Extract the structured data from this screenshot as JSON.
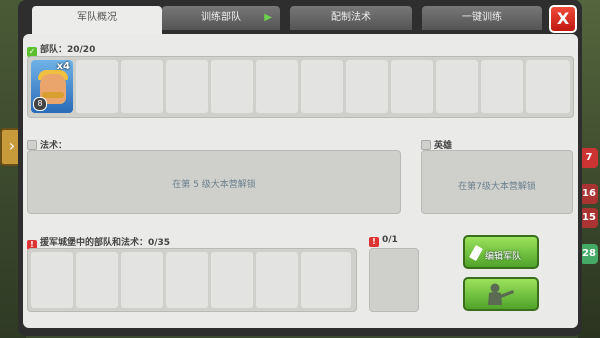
{
  "tabs": [
    {
      "label": "军队概况",
      "active": true
    },
    {
      "label": "训练部队",
      "active": false
    },
    {
      "label": "配制法术",
      "active": false
    },
    {
      "label": "一键训练",
      "active": false
    }
  ],
  "close_label": "X",
  "troops": {
    "label": "部队：20/20",
    "unit_count": "x4",
    "unit_level": "8",
    "unit_name": "barbarian"
  },
  "spells": {
    "label": "法术：",
    "locked_text": "在第 5 级大本营解锁"
  },
  "heroes": {
    "label": "英雄",
    "locked_text": "在第7级大本营解锁"
  },
  "reinforcements": {
    "label": "援军城堡中的部队和法术：0/35"
  },
  "siege": {
    "label": "0/1"
  },
  "edit_army_button": "编辑军队",
  "right_badges": [
    "7",
    "16",
    "15",
    "28"
  ],
  "colors": {
    "green_button": "#6cc23a",
    "close_red": "#e0291f",
    "panel": "#eaeae8"
  }
}
